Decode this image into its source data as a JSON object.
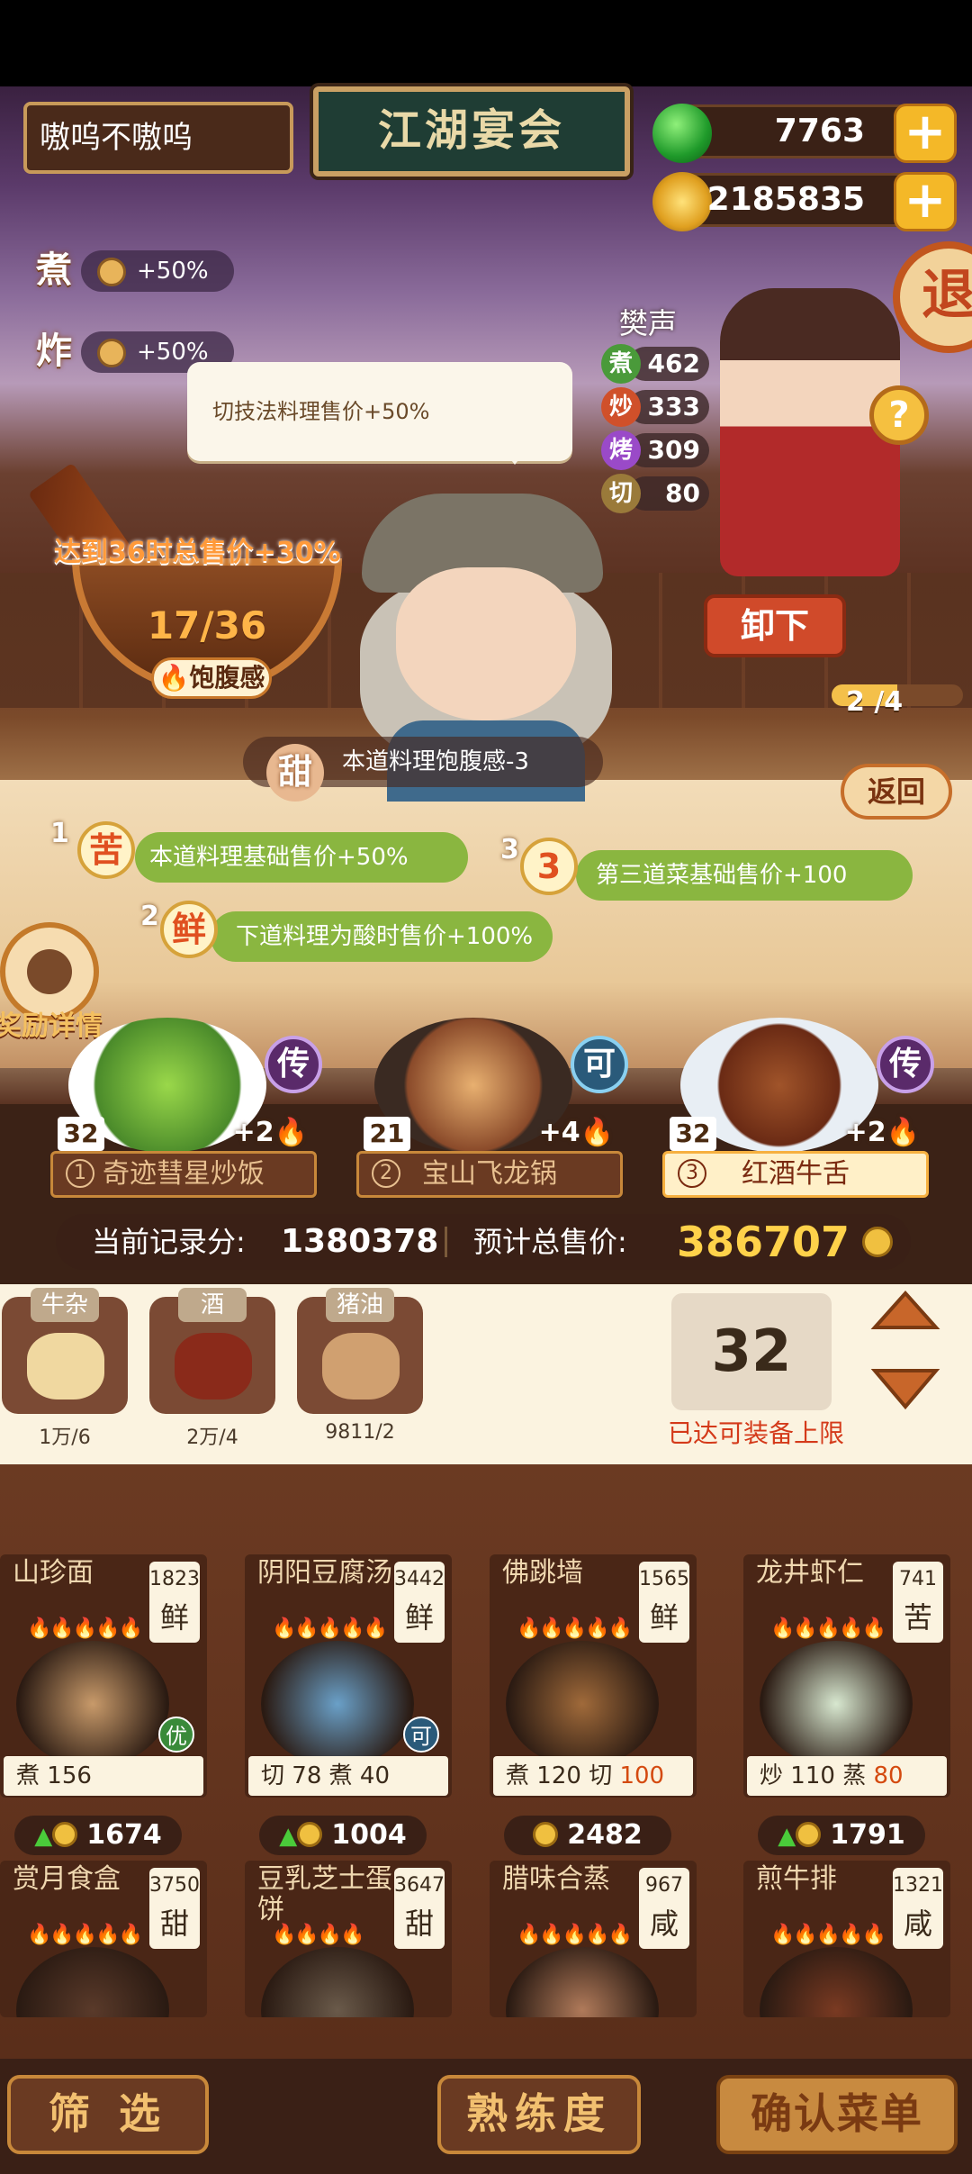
{
  "header": {
    "player_name": "嗷呜不嗷呜",
    "event_title": "江湖宴会",
    "jade": "7763",
    "coins": "2185835",
    "exit_label": "退"
  },
  "buffs": [
    {
      "method": "煮",
      "value": "+50%"
    },
    {
      "method": "炸",
      "value": "+50%"
    }
  ],
  "tooltip": "切技法料理售价+50%",
  "fullness": {
    "goal_text": "达到36时总售价+30%",
    "progress": "17/36",
    "label": "饱腹感",
    "current": 17,
    "target": 36
  },
  "chef_skills": {
    "sweet": {
      "flavor": "甜",
      "text": "本道料理饱腹感-3"
    },
    "skill1": {
      "num": "1",
      "flavor": "苦",
      "text": "本道料理基础售价+50%"
    },
    "skill2": {
      "num": "2",
      "flavor": "鲜",
      "text": "下道料理为酸时售价+100%"
    },
    "skill3": {
      "num": "3",
      "flavor": "3",
      "text": "第三道菜基础售价+100"
    }
  },
  "guest": {
    "name": "樊声",
    "stats": [
      {
        "method": "煮",
        "value": "462",
        "color": "#4a9a3a"
      },
      {
        "method": "炒",
        "value": "333",
        "color": "#d0502a"
      },
      {
        "method": "烤",
        "value": "309",
        "color": "#9a4ac8"
      },
      {
        "method": "切",
        "value": "80",
        "color": "#9a7a3a"
      }
    ],
    "unload_label": "卸下",
    "back_label": "返回",
    "help_label": "?",
    "page": "2 /4",
    "page_fraction": 0.5
  },
  "reward": {
    "label": "奖励详情"
  },
  "selected_dishes": [
    {
      "index": "1",
      "name": "奇迹彗星炒饭",
      "level": "32",
      "bonus": "+2",
      "rarity": "传",
      "selected": false
    },
    {
      "index": "2",
      "name": "宝山飞龙锅",
      "level": "21",
      "bonus": "+4",
      "rarity": "可",
      "selected": false
    },
    {
      "index": "3",
      "name": "红酒牛舌",
      "level": "32",
      "bonus": "+2",
      "rarity": "传",
      "selected": true
    }
  ],
  "score": {
    "record_label": "当前记录分:",
    "record_value": "1380378",
    "total_label": "预计总售价:",
    "total_value": "386707"
  },
  "inventory": [
    {
      "name": "牛杂",
      "count": "1万/6"
    },
    {
      "name": "酒",
      "count": "2万/4"
    },
    {
      "name": "猪油",
      "count": "9811/2"
    }
  ],
  "quantity": {
    "value": "32",
    "limit_text": "已达可装备上限"
  },
  "recipes": [
    {
      "name": "山珍面",
      "level": "1823",
      "flavor": "鲜",
      "fires": "🔥🔥🔥🔥🔥",
      "skills": [
        {
          "m": "煮",
          "v": "156"
        }
      ],
      "price": "1674",
      "up": true,
      "badge": "优"
    },
    {
      "name": "阴阳豆腐汤",
      "level": "3442",
      "flavor": "鲜",
      "fires": "🔥🔥🔥🔥🔥",
      "skills": [
        {
          "m": "切",
          "v": "78"
        },
        {
          "m": "煮",
          "v": "40"
        }
      ],
      "price": "1004",
      "up": true,
      "badge": "可"
    },
    {
      "name": "佛跳墙",
      "level": "1565",
      "flavor": "鲜",
      "fires": "🔥🔥🔥🔥🔥",
      "skills": [
        {
          "m": "煮",
          "v": "120"
        },
        {
          "m": "切",
          "v": "100",
          "hi": true
        }
      ],
      "price": "2482",
      "up": false,
      "badge": ""
    },
    {
      "name": "龙井虾仁",
      "level": "741",
      "flavor": "苦",
      "fires": "🔥🔥🔥🔥🔥",
      "skills": [
        {
          "m": "炒",
          "v": "110"
        },
        {
          "m": "蒸",
          "v": "80",
          "hi": true
        }
      ],
      "price": "1791",
      "up": true,
      "badge": ""
    },
    {
      "name": "赏月食盒",
      "level": "3750",
      "flavor": "甜",
      "fires": "🔥🔥🔥🔥🔥",
      "skills": [],
      "price": "",
      "up": false,
      "badge": ""
    },
    {
      "name": "豆乳芝士蛋饼",
      "level": "3647",
      "flavor": "甜",
      "fires": "🔥🔥🔥🔥",
      "skills": [],
      "price": "",
      "up": false,
      "badge": ""
    },
    {
      "name": "腊味合蒸",
      "level": "967",
      "flavor": "咸",
      "fires": "🔥🔥🔥🔥🔥",
      "skills": [],
      "price": "",
      "up": false,
      "badge": ""
    },
    {
      "name": "煎牛排",
      "level": "1321",
      "flavor": "咸",
      "fires": "🔥🔥🔥🔥🔥",
      "skills": [],
      "price": "",
      "up": false,
      "badge": ""
    }
  ],
  "bottom": {
    "filter_label": "筛 选",
    "mastery_label": "熟练度",
    "confirm_label": "确认菜单"
  }
}
